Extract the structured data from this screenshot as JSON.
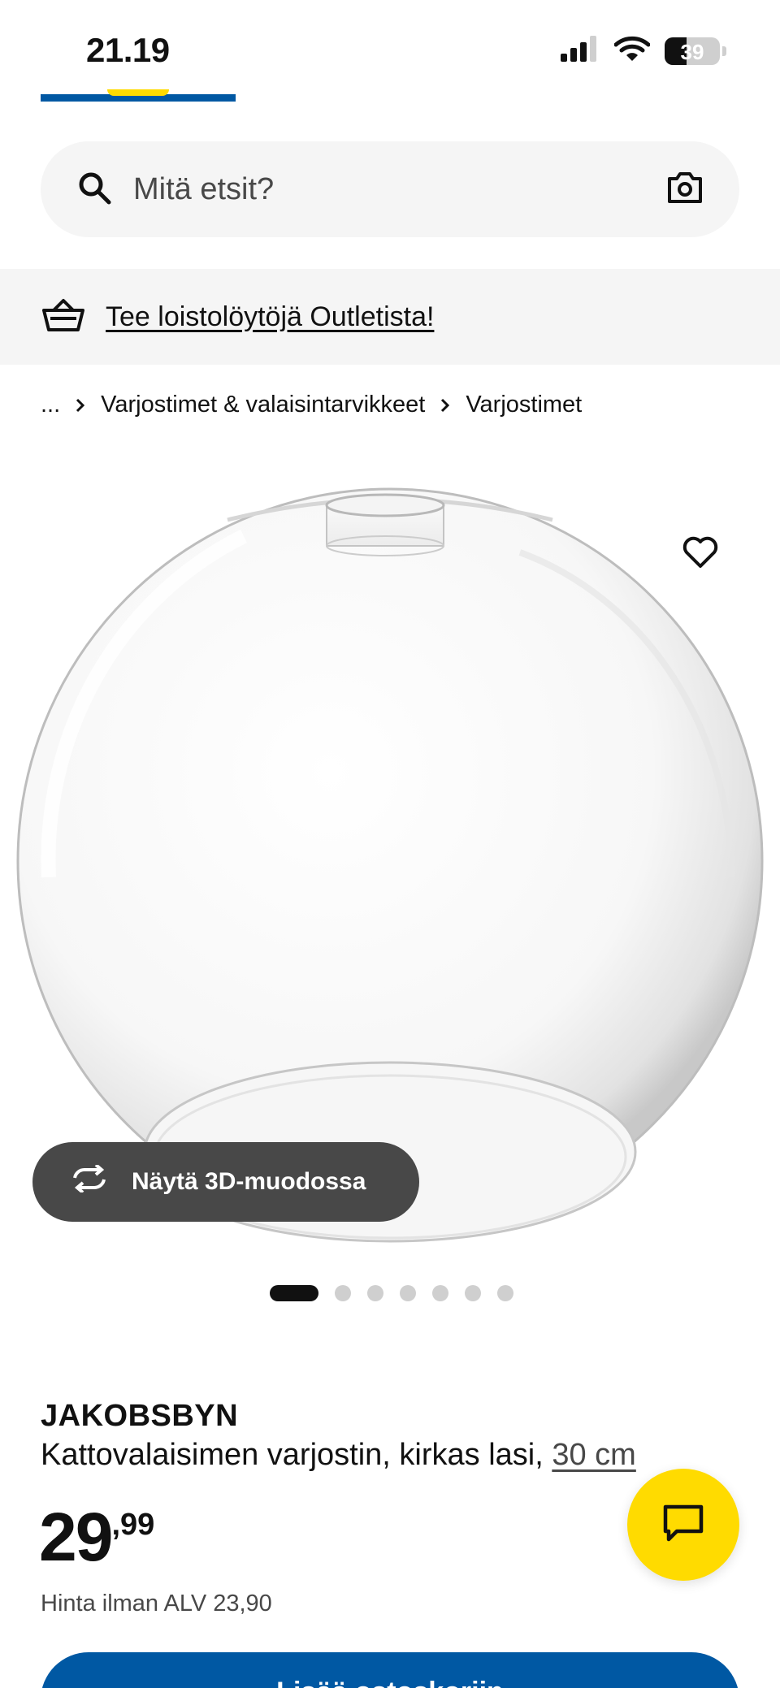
{
  "status_bar": {
    "time": "21.19",
    "battery": "39",
    "battery_level_percent": 39
  },
  "search": {
    "placeholder": "Mitä etsit?",
    "icon": "search-icon",
    "camera_icon": "camera-icon"
  },
  "promo": {
    "icon": "basket-icon",
    "text": "Tee loistolöytöjä Outletista!"
  },
  "breadcrumb": {
    "ellipsis": "...",
    "items": [
      "Varjostimet & valaisintarvikkeet",
      "Varjostimet"
    ]
  },
  "gallery": {
    "image": "glass globe lamp shade",
    "favourite_icon": "heart-icon",
    "view_3d_label": "Näytä 3D-muodossa",
    "image_count": 7,
    "active_index": 0
  },
  "product": {
    "name": "JAKOBSBYN",
    "description": "Kattovalaisimen varjostin, kirkas lasi,",
    "size": "30 cm",
    "price_integer": "29",
    "price_decimal": ",99",
    "vat_text": "Hinta ilman ALV 23,90",
    "add_to_cart": "Lisää ostoskoriin"
  },
  "chat": {
    "icon": "chat-icon"
  },
  "colors": {
    "brand_blue": "#0058a3",
    "brand_yellow": "#ffdb00",
    "chip_dark": "#484848",
    "surface": "#f5f5f5"
  }
}
